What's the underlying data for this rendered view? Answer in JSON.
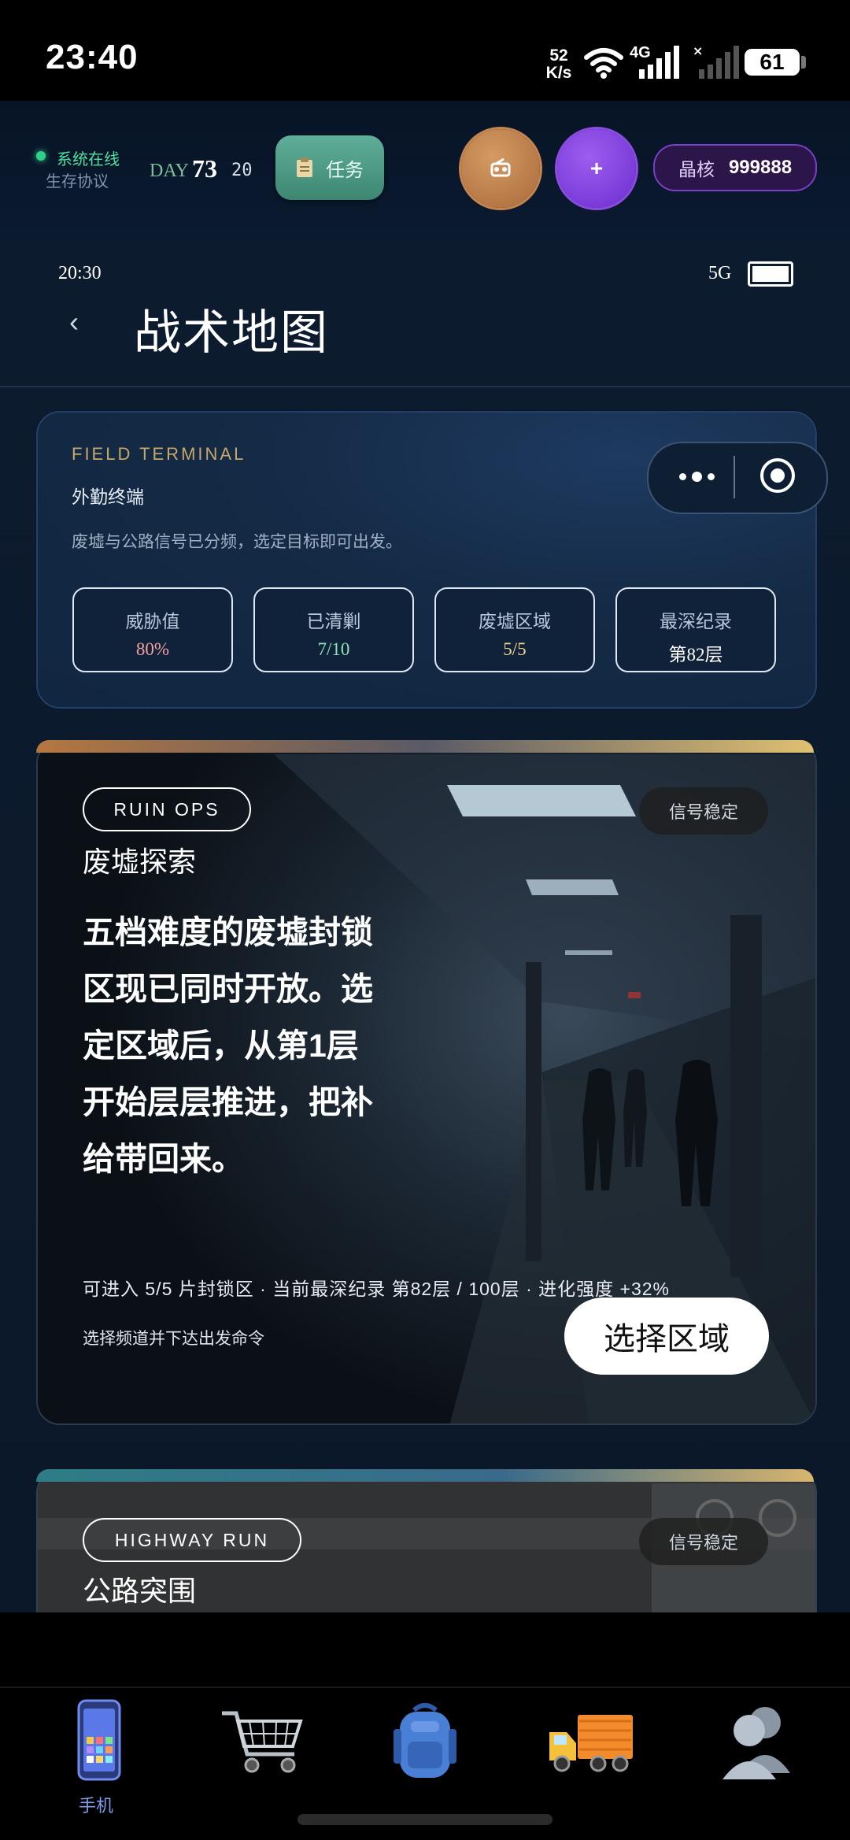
{
  "os_status": {
    "time": "23:40",
    "net_speed_value": "52",
    "net_speed_unit": "K/s",
    "network_type": "4G",
    "battery": "61"
  },
  "hud": {
    "online_text": "系统在线",
    "protocol_text": "生存协议",
    "day_label": "DAY",
    "day_value": "73",
    "day_sub": "20",
    "task_label": "任务",
    "plus_label": "+",
    "core_label": "晶核",
    "core_value": "999888"
  },
  "inner_status": {
    "time": "20:30",
    "network": "5G"
  },
  "page_title": "战术地图",
  "terminal": {
    "kicker": "FIELD TERMINAL",
    "title": "外勤终端",
    "description": "废墟与公路信号已分频，选定目标即可出发。",
    "stats": [
      {
        "label": "威胁值",
        "value": "80%",
        "color": "#f4a0a0"
      },
      {
        "label": "已清剿",
        "value": "7/10",
        "color": "#8fe3b6"
      },
      {
        "label": "废墟区域",
        "value": "5/5",
        "color": "#f3d88a"
      },
      {
        "label": "最深纪录",
        "value": "第82层",
        "color": "#ffffff"
      }
    ]
  },
  "ruin": {
    "tag": "RUIN OPS",
    "signal": "信号稳定",
    "title": "废墟探索",
    "description": "五档难度的废墟封锁区现已同时开放。选定区域后，从第1层开始层层推进，把补给带回来。",
    "meta": "可进入 5/5 片封锁区 · 当前最深纪录 第82层 / 100层 · 进化强度 +32%",
    "hint": "选择频道并下达出发命令",
    "action": "选择区域"
  },
  "highway": {
    "tag": "HIGHWAY RUN",
    "signal": "信号稳定",
    "title": "公路突围"
  },
  "nav": {
    "active_label": "手机",
    "items": [
      "phone-icon",
      "shopping-cart-icon",
      "backpack-icon",
      "truck-icon",
      "profile-icon"
    ]
  },
  "colors": {
    "accent_green": "#4fe0a0",
    "accent_purple": "#7b3ec8",
    "accent_gold": "#c7a86a",
    "background": "#0d1b2e"
  }
}
